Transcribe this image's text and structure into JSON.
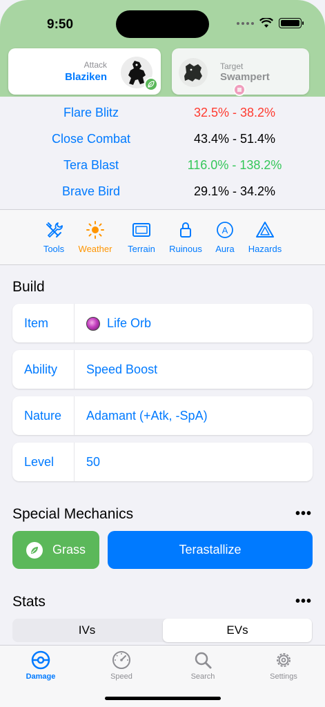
{
  "status": {
    "time": "9:50"
  },
  "attacker": {
    "role": "Attack",
    "name": "Blaziken",
    "type_icon": "leaf-icon"
  },
  "target": {
    "role": "Target",
    "name": "Swampert",
    "type_icon": "tera-icon"
  },
  "moves": [
    {
      "name": "Flare Blitz",
      "damage": "32.5% - 38.2%",
      "color": "#ff3b30"
    },
    {
      "name": "Close Combat",
      "damage": "43.4% - 51.4%",
      "color": "#000000"
    },
    {
      "name": "Tera Blast",
      "damage": "116.0% - 138.2%",
      "color": "#34c759"
    },
    {
      "name": "Brave Bird",
      "damage": "29.1% - 34.2%",
      "color": "#000000"
    }
  ],
  "field": {
    "items": [
      {
        "label": "Tools",
        "icon": "tools-icon"
      },
      {
        "label": "Weather",
        "icon": "sun-icon",
        "active": true
      },
      {
        "label": "Terrain",
        "icon": "terrain-icon"
      },
      {
        "label": "Ruinous",
        "icon": "lock-icon"
      },
      {
        "label": "Aura",
        "icon": "aura-icon"
      },
      {
        "label": "Hazards",
        "icon": "hazard-icon"
      }
    ]
  },
  "build": {
    "title": "Build",
    "rows": [
      {
        "label": "Item",
        "value": "Life Orb",
        "icon": "life-orb-icon"
      },
      {
        "label": "Ability",
        "value": "Speed Boost"
      },
      {
        "label": "Nature",
        "value": "Adamant (+Atk, -SpA)"
      },
      {
        "label": "Level",
        "value": "50"
      }
    ]
  },
  "mechanics": {
    "title": "Special Mechanics",
    "more": "•••",
    "tera_type": "Grass",
    "tera_button": "Terastallize"
  },
  "stats": {
    "title": "Stats",
    "more": "•••",
    "segments": [
      "IVs",
      "EVs"
    ],
    "selected": "EVs"
  },
  "tabs": [
    {
      "label": "Damage",
      "icon": "pokeball-icon",
      "active": true
    },
    {
      "label": "Speed",
      "icon": "speedometer-icon"
    },
    {
      "label": "Search",
      "icon": "search-icon"
    },
    {
      "label": "Settings",
      "icon": "gear-icon"
    }
  ],
  "colors": {
    "accent": "#007aff",
    "grass": "#5bb85a",
    "header": "#a8d5a2",
    "weather": "#ff9500"
  }
}
